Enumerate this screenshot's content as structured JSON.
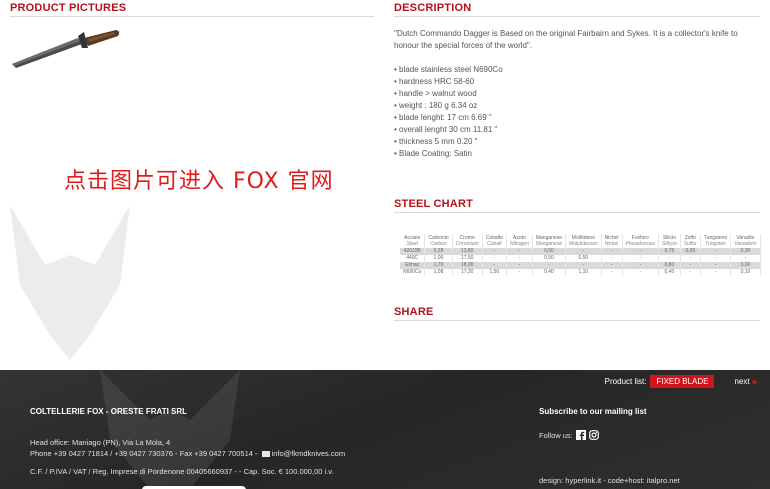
{
  "left": {
    "title": "PRODUCT PICTURES",
    "overlay": "点击图片可进入 FOX 官网"
  },
  "right": {
    "title": "DESCRIPTION",
    "intro": "\"Dutch Commando Dagger is Based on the original Fairbairn and Sykes. It is a collector's knife to honour the special forces of the world\".",
    "specs": [
      "blade stainless steel N690Co",
      "hardness HRC 58-60",
      "handle > walnut wood",
      "weight : 180 g 6.34 oz",
      "blade lenght: 17 cm 6.69 \"",
      "overall lenght 30 cm 11.81 \"",
      "thickness 5 mm 0.20 \"",
      "Blade Coating: Satin"
    ],
    "steel_title": "STEEL CHART",
    "share_title": "SHARE"
  },
  "steel_table": {
    "headers": [
      [
        "Acciaio",
        "Steel"
      ],
      [
        "Carbonio",
        "Carbon"
      ],
      [
        "Cromo",
        "Chromium"
      ],
      [
        "Cobalto",
        "Cobalt"
      ],
      [
        "Azoto",
        "Nitrogen"
      ],
      [
        "Manganese",
        "Manganese"
      ],
      [
        "Molibdeno",
        "Molybdenum"
      ],
      [
        "Nichel",
        "Nickel"
      ],
      [
        "Fosforo",
        "Phosphorous"
      ],
      [
        "Silicio",
        "Silicon"
      ],
      [
        "Zolfo",
        "Sulfur"
      ],
      [
        "Tungsteno",
        "Tungsten"
      ],
      [
        "Vanadio",
        "Vanadium"
      ]
    ],
    "rows": [
      {
        "shade": "shade",
        "cells": [
          "420J2B",
          "0,38",
          "13,60",
          "-",
          "-",
          "0,50",
          "-",
          "-",
          "-",
          "0,75",
          "0,03",
          "-",
          "0,30"
        ]
      },
      {
        "shade": "",
        "cells": [
          "440C",
          "1,00",
          "17,50",
          "-",
          "-",
          "0,50",
          "0,50",
          "-",
          "-",
          "-",
          "-",
          "-",
          "-"
        ]
      },
      {
        "shade": "shade",
        "cells": [
          "Elmax",
          "1,70",
          "18,00",
          "-",
          "-",
          "-",
          "-",
          "-",
          "-",
          "0,80",
          "-",
          "-",
          "3,00"
        ]
      },
      {
        "shade": "",
        "cells": [
          "N690Co",
          "1,08",
          "17,30",
          "1,50",
          "-",
          "0,40",
          "1,10",
          "-",
          "-",
          "0,40",
          "-",
          "-",
          "0,10"
        ]
      }
    ]
  },
  "footer": {
    "product_list_label": "Product list:",
    "product_list_value": "FIXED BLADE",
    "next_label": "next",
    "company": "COLTELLERIE FOX - ORESTE FRATI SRL",
    "address_line1": "Head office: Maniago (PN), Via La Mola, 4",
    "address_line2_a": "Phone +39 0427 71814 / +39 0427 730376 - Fax +39 0427 700514 -",
    "email": "info@fkmdknives.com",
    "vat": "C.F. / P.IVA / VAT / Reg. Imprese di Pordenone 00405660937 - - Cap. Soc. € 100.000,00 i.v.",
    "mailing": "Subscribe to our mailing list",
    "follow": "Follow us:",
    "design": "design: hyperlink.it - code+host: italpro.net"
  },
  "colors": {
    "accent": "#b3121d",
    "badge": "#d0141c",
    "footer_bg": "#2b2b2b"
  }
}
